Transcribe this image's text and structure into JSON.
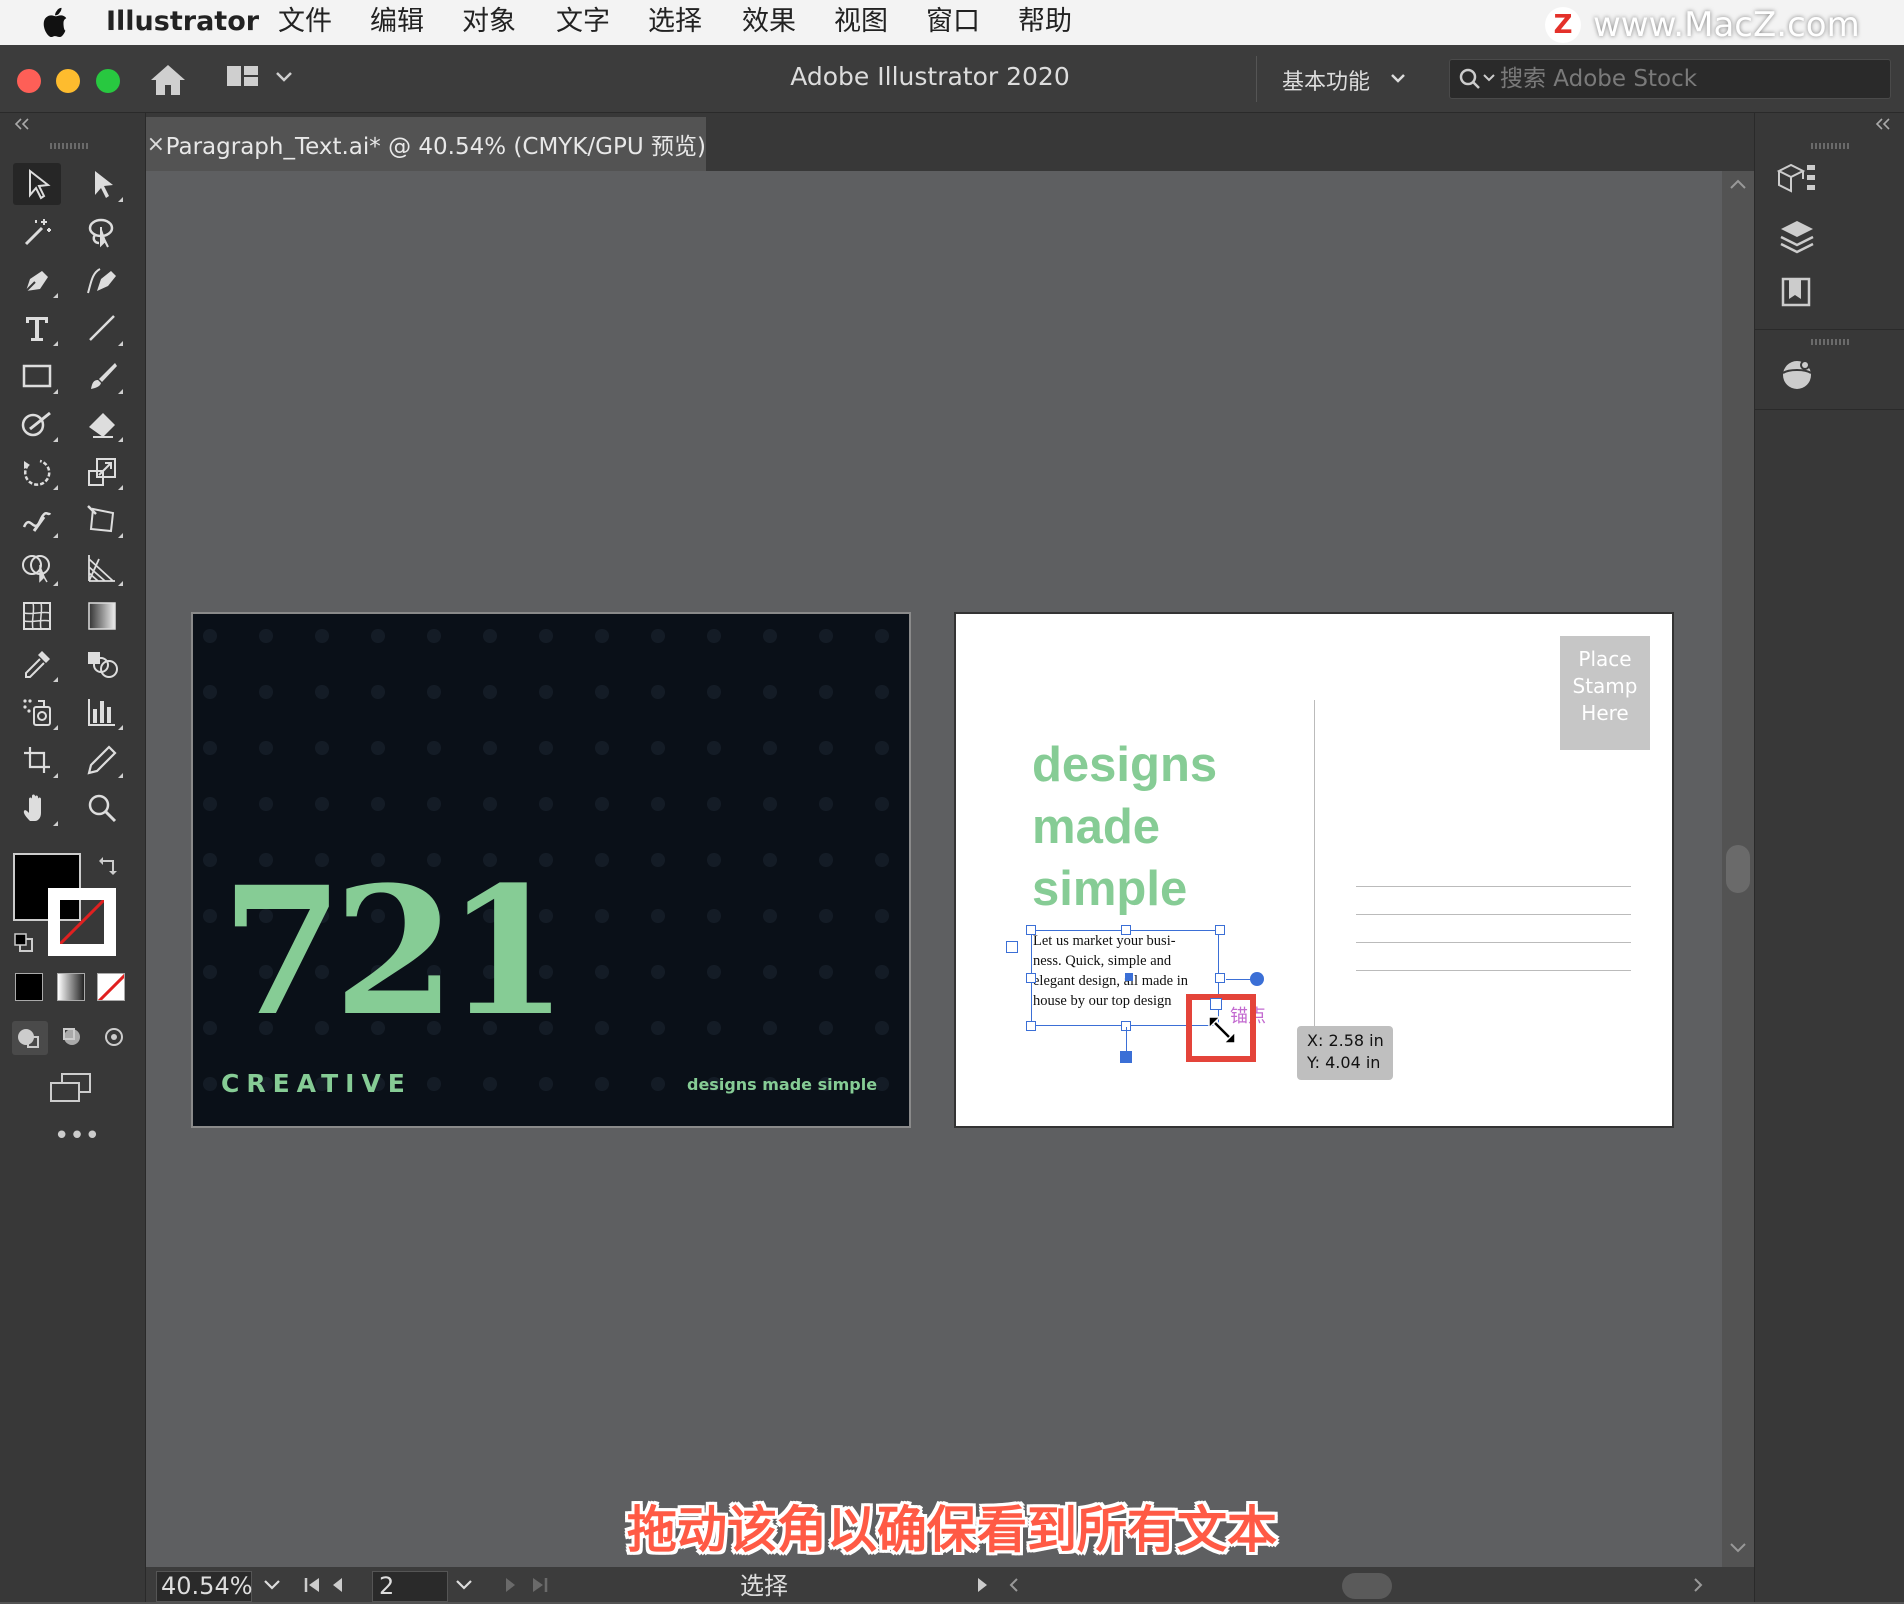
{
  "menubar": {
    "app_name": "Illustrator",
    "items": [
      "文件",
      "编辑",
      "对象",
      "文字",
      "选择",
      "效果",
      "视图",
      "窗口",
      "帮助"
    ],
    "watermark": "www.MacZ.com",
    "watermark_logo": "Z"
  },
  "titlebar": {
    "title": "Adobe Illustrator 2020",
    "workspace": "基本功能",
    "search_placeholder": "搜索 Adobe Stock"
  },
  "document": {
    "tab_label": "Paragraph_Text.ai* @ 40.54% (CMYK/GPU 预览)",
    "close_glyph": "×"
  },
  "artboard_front": {
    "number": "721",
    "brand": "CREATIVE",
    "tagline": "designs made simple",
    "colors": {
      "background": "#0a1018",
      "accent": "#86cc95"
    }
  },
  "artboard_back": {
    "heading_lines": [
      "designs",
      "made",
      "simple"
    ],
    "stamp_lines": [
      "Place",
      "Stamp",
      "Here"
    ],
    "body_lines": [
      "Let us market your busi-",
      "ness. Quick, simple and",
      "elegant design, all made in",
      "house by our top design"
    ],
    "anchor_label": "锚点",
    "coord_x": "X: 2.58 in",
    "coord_y": "Y: 4.04 in"
  },
  "statusbar": {
    "zoom": "40.54%",
    "artboard_number": "2",
    "tool_name": "选择"
  },
  "subtitle": "拖动该角以确保看到所有文本",
  "colors": {
    "highlight": "#e4443a",
    "selection": "#3b6fd6",
    "subtitle": "#ff5a45"
  }
}
